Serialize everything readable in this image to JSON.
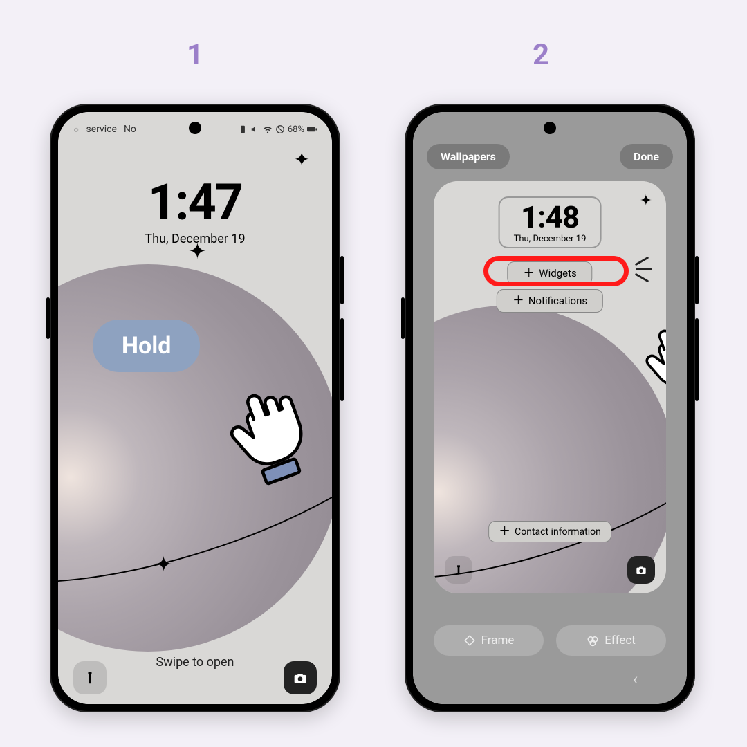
{
  "steps": {
    "one": "1",
    "two": "2"
  },
  "phone1": {
    "status_left": "service",
    "status_left2": "No",
    "battery": "68%",
    "time": "1:47",
    "date": "Thu, December 19",
    "swipe": "Swipe to open",
    "hold_label": "Hold"
  },
  "phone2": {
    "wallpapers_btn": "Wallpapers",
    "done_btn": "Done",
    "time": "1:48",
    "date": "Thu, December 19",
    "add_widgets": "Widgets",
    "add_notifications": "Notifications",
    "add_contact": "Contact information",
    "frame_btn": "Frame",
    "effect_btn": "Effect"
  }
}
